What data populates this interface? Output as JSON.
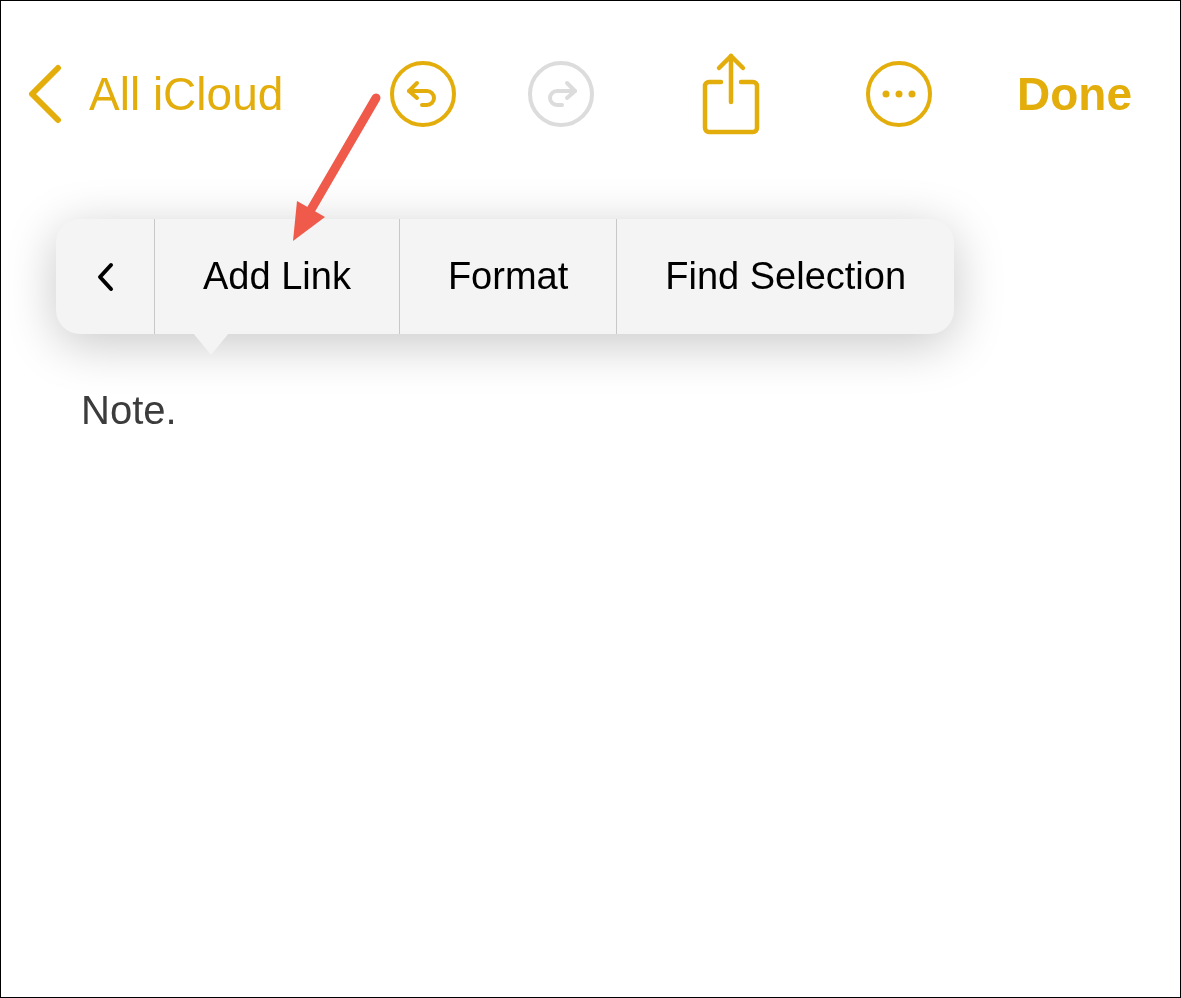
{
  "toolbar": {
    "back_label": "All iCloud",
    "done_label": "Done",
    "undo_enabled": true,
    "redo_enabled": false
  },
  "note": {
    "body_lines": [
      "Note."
    ]
  },
  "edit_menu": {
    "items": [
      {
        "kind": "back"
      },
      {
        "kind": "text",
        "label": "Add Link"
      },
      {
        "kind": "text",
        "label": "Format"
      },
      {
        "kind": "text",
        "label": "Find Selection"
      }
    ]
  }
}
